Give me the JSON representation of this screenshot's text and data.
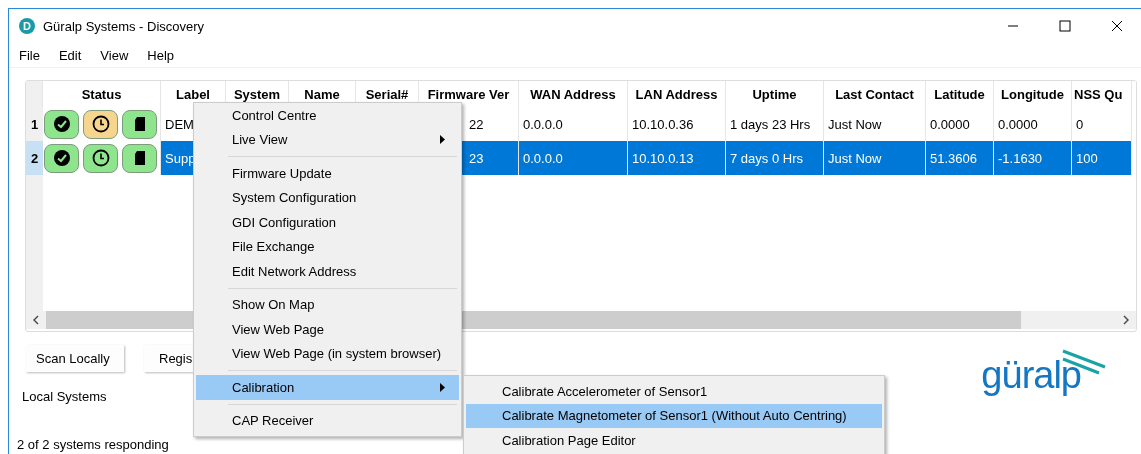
{
  "window": {
    "title": "Güralp Systems - Discovery",
    "icon_letter": "D"
  },
  "menu_bar": [
    "File",
    "Edit",
    "View",
    "Help"
  ],
  "table": {
    "columns": [
      "Status",
      "Label",
      "System",
      "Name",
      "Serial#",
      "Firmware Ver",
      "WAN Address",
      "LAN Address",
      "Uptime",
      "Last Contact",
      "Latitude",
      "Longitude",
      "NSS Qu"
    ],
    "rows": [
      {
        "number": "1",
        "selected": false,
        "status": [
          {
            "kind": "check",
            "color": "#8ee58e"
          },
          {
            "kind": "clock",
            "color": "#f6d58f"
          },
          {
            "kind": "card",
            "color": "#8ee58e"
          }
        ],
        "label": "DEM",
        "firmware_ver": "22",
        "wan_address": "0.0.0.0",
        "lan_address": "10.10.0.36",
        "uptime": "1 days 23 Hrs",
        "last_contact": "Just Now",
        "latitude": "0.0000",
        "longitude": "0.0000",
        "gnss_qu": "0"
      },
      {
        "number": "2",
        "selected": true,
        "status": [
          {
            "kind": "check",
            "color": "#8ee58e"
          },
          {
            "kind": "clock",
            "color": "#8ee58e"
          },
          {
            "kind": "card",
            "color": "#8ee58e"
          }
        ],
        "label": "Supp",
        "firmware_ver": "23",
        "wan_address": "0.0.0.0",
        "lan_address": "10.10.0.13",
        "uptime": "7 days 0 Hrs",
        "last_contact": "Just Now",
        "latitude": "51.3606",
        "longitude": "-1.1630",
        "gnss_qu": "100"
      }
    ]
  },
  "buttons": [
    "Scan Locally",
    "Regis"
  ],
  "section_label": "Local Systems",
  "logo": "güralp",
  "status_bar": "2 of 2 systems responding",
  "context_menu": [
    {
      "kind": "item",
      "label": "Control Centre",
      "submenu": false,
      "selected": false
    },
    {
      "kind": "item",
      "label": "Live View",
      "submenu": true,
      "selected": false
    },
    {
      "kind": "separator"
    },
    {
      "kind": "item",
      "label": "Firmware Update",
      "submenu": false,
      "selected": false
    },
    {
      "kind": "item",
      "label": "System Configuration",
      "submenu": false,
      "selected": false
    },
    {
      "kind": "item",
      "label": "GDI Configuration",
      "submenu": false,
      "selected": false
    },
    {
      "kind": "item",
      "label": "File Exchange",
      "submenu": false,
      "selected": false
    },
    {
      "kind": "item",
      "label": "Edit Network Address",
      "submenu": false,
      "selected": false
    },
    {
      "kind": "separator"
    },
    {
      "kind": "item",
      "label": "Show On Map",
      "submenu": false,
      "selected": false
    },
    {
      "kind": "item",
      "label": "View Web Page",
      "submenu": false,
      "selected": false
    },
    {
      "kind": "item",
      "label": "View Web Page (in system browser)",
      "submenu": false,
      "selected": false
    },
    {
      "kind": "separator"
    },
    {
      "kind": "item",
      "label": "Calibration",
      "submenu": true,
      "selected": true
    },
    {
      "kind": "separator"
    },
    {
      "kind": "item",
      "label": "CAP Receiver",
      "submenu": false,
      "selected": false
    }
  ],
  "submenu": [
    {
      "label": "Calibrate Accelerometer of Sensor1",
      "selected": false
    },
    {
      "label": "Calibrate Magnetometer of Sensor1 (Without Auto Centring)",
      "selected": true
    },
    {
      "label": "Calibration Page Editor",
      "selected": false
    }
  ]
}
